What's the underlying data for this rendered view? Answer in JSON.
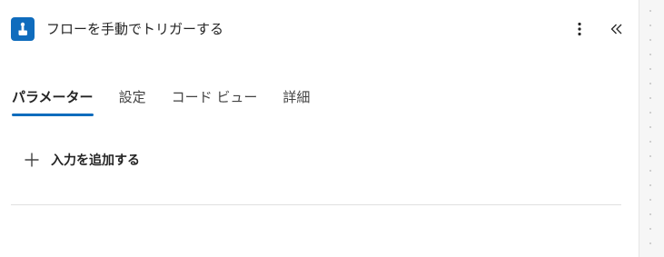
{
  "header": {
    "title": "フローを手動でトリガーする",
    "trigger_icon": "hand-touch-icon",
    "more_icon": "more-vertical-icon",
    "collapse_icon": "double-chevron-left-icon"
  },
  "tabs": [
    {
      "label": "パラメーター",
      "active": true
    },
    {
      "label": "設定",
      "active": false
    },
    {
      "label": "コード ビュー",
      "active": false
    },
    {
      "label": "詳細",
      "active": false
    }
  ],
  "parameters": {
    "add_input_label": "入力を追加する",
    "add_icon": "plus-icon"
  },
  "colors": {
    "accent": "#0f6cbd",
    "text": "#242424",
    "divider": "#e0e0e0"
  }
}
